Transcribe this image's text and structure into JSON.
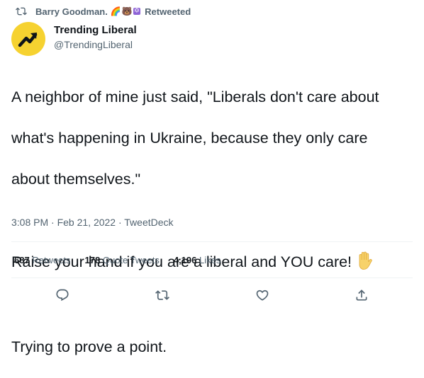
{
  "retweet_header": {
    "retweeter_name": "Barry Goodman.",
    "emojis": [
      "🌈",
      "🐻",
      "✡"
    ],
    "label": "Retweeted",
    "icon": "retweet-icon"
  },
  "author": {
    "display_name": "Trending Liberal",
    "handle": "@TrendingLiberal",
    "avatar_icon": "trending-arrow-icon",
    "avatar_color": "#f6d230"
  },
  "tweet": {
    "paragraph1": [
      "A neighbor of mine just said, \"Liberals don't care about",
      "what's happening in Ukraine, because they only care",
      "about themselves.\""
    ],
    "paragraph2": "Raise your hand if you are a liberal and YOU care!",
    "paragraph2_emoji": "raised-hand-icon",
    "paragraph3": "Trying to prove a point."
  },
  "meta": {
    "text": "3:08 PM · Feb 21, 2022 · TweetDeck"
  },
  "stats": {
    "retweets_count": "687",
    "retweets_label": "Retweets",
    "quotes_count": "178",
    "quotes_label": "Quote Tweets",
    "likes_count": "4,196",
    "likes_label": "Likes"
  },
  "actions": [
    "reply-icon",
    "retweet-icon",
    "like-icon",
    "share-icon"
  ],
  "colors": {
    "text": "#0f1419",
    "secondary": "#536471",
    "divider": "#eff3f4"
  }
}
